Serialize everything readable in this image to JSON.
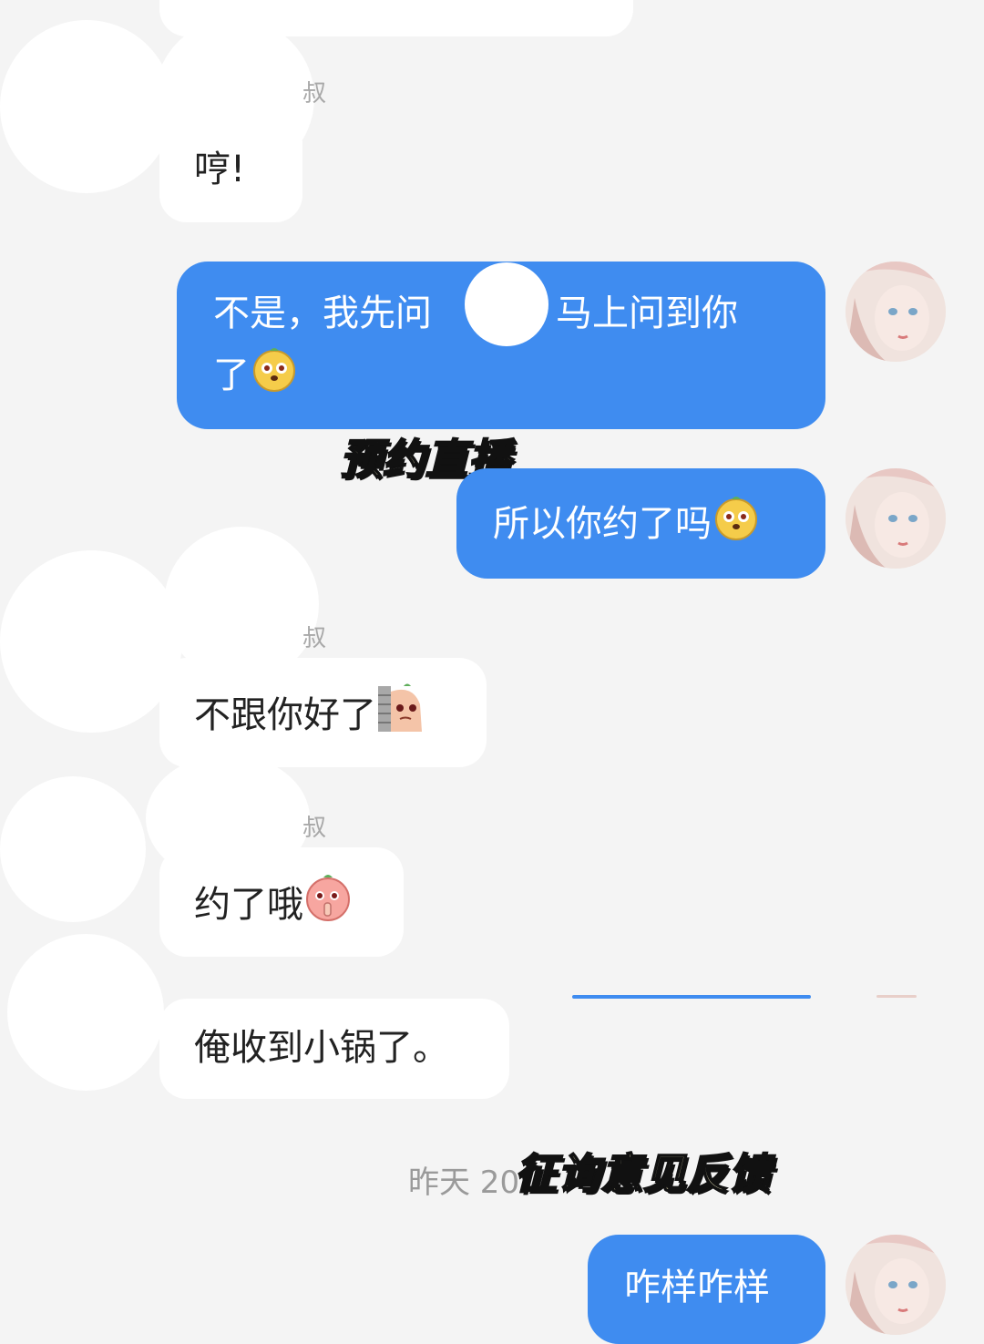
{
  "messages": {
    "in_1": "哼!",
    "out_1_line1_a": "不是，我先问",
    "out_1_line1_b": "，马上问到你",
    "out_1_line2": "了",
    "out_2": "所以你约了吗",
    "in_2": "不跟你好了",
    "in_3": "约了哦",
    "in_4": "俺收到小锅了。",
    "out_3": "咋样咋样"
  },
  "sender_name_fragment": "叔",
  "timestamp": "昨天 20",
  "overlays": {
    "caption_1": "预约直播",
    "caption_2": "征询意见反馈"
  },
  "colors": {
    "background": "#f4f4f4",
    "incoming_bubble": "#ffffff",
    "outgoing_bubble": "#3f8cf0",
    "overlay_text": "#fff9c9"
  },
  "icons": {
    "emoji_dog": "dog-face-emoji",
    "emoji_peek": "peek-behind-wall-emoji",
    "emoji_shh": "shh-peach-emoji"
  }
}
